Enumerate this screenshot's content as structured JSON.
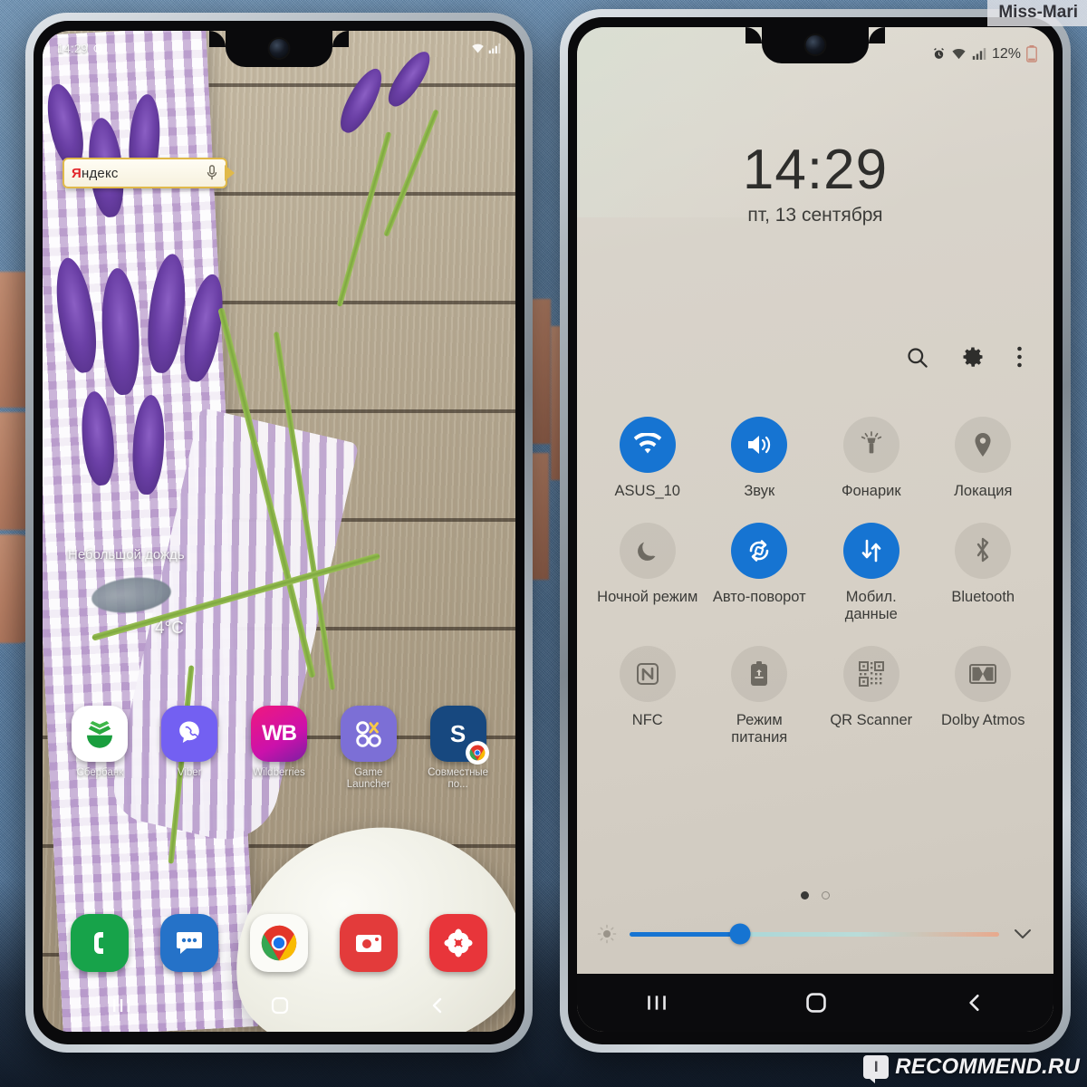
{
  "watermarks": {
    "top_right": "Miss-Mari",
    "bottom_right": "RECOMMEND.RU",
    "badge_glyph": "I"
  },
  "left_phone": {
    "screen_name": "home-screen",
    "status_bar": {
      "time": "14:29",
      "icons": [
        "alarm-icon",
        "wifi-icon",
        "signal-icon"
      ]
    },
    "search_widget": {
      "brand_first_letter": "Я",
      "brand_rest": "ндекс",
      "mic_icon": "microphone-icon"
    },
    "weather": {
      "description": "Небольшой дождь",
      "temperature": "4°C",
      "icon": "rain-cloud-icon"
    },
    "apps": [
      {
        "label": "Сбербанк",
        "icon": "sberbank-icon"
      },
      {
        "label": "Viber",
        "icon": "viber-icon"
      },
      {
        "label": "Wildberries",
        "icon": "wildberries-icon"
      },
      {
        "label": "Game Launcher",
        "icon": "game-launcher-icon"
      },
      {
        "label": "Совместные по...",
        "icon": "samsung-shared-icon"
      }
    ],
    "dock": [
      {
        "label": "Телефон",
        "icon": "phone-icon"
      },
      {
        "label": "Сообщения",
        "icon": "messages-icon"
      },
      {
        "label": "Chrome",
        "icon": "chrome-icon"
      },
      {
        "label": "Камера",
        "icon": "camera-icon"
      },
      {
        "label": "Галерея",
        "icon": "gallery-icon"
      }
    ],
    "navbar": {
      "recents": "recents-icon",
      "home": "home-icon",
      "back": "back-icon"
    }
  },
  "right_phone": {
    "screen_name": "quick-settings-panel",
    "status_bar": {
      "battery_percent": "12%",
      "icons": [
        "alarm-icon",
        "wifi-icon",
        "signal-icon",
        "battery-icon"
      ]
    },
    "clock": "14:29",
    "date": "пт, 13 сентября",
    "header_actions": [
      {
        "name": "search-icon"
      },
      {
        "name": "settings-gear-icon"
      },
      {
        "name": "more-options-icon"
      }
    ],
    "toggles": [
      [
        {
          "label": "ASUS_10",
          "icon": "wifi-icon",
          "active": true
        },
        {
          "label": "Звук",
          "icon": "sound-icon",
          "active": true
        },
        {
          "label": "Фонарик",
          "icon": "flashlight-icon",
          "active": false
        },
        {
          "label": "Локация",
          "icon": "location-pin-icon",
          "active": false
        }
      ],
      [
        {
          "label": "Ночной режим",
          "icon": "moon-icon",
          "active": false
        },
        {
          "label": "Авто-поворот",
          "icon": "auto-rotate-icon",
          "active": true
        },
        {
          "label": "Мобил. данные",
          "icon": "mobile-data-icon",
          "active": true
        },
        {
          "label": "Bluetooth",
          "icon": "bluetooth-icon",
          "active": false
        }
      ],
      [
        {
          "label": "NFC",
          "icon": "nfc-icon",
          "active": false
        },
        {
          "label": "Режим питания",
          "icon": "power-mode-icon",
          "active": false
        },
        {
          "label": "QR Scanner",
          "icon": "qr-scanner-icon",
          "active": false
        },
        {
          "label": "Dolby Atmos",
          "icon": "dolby-atmos-icon",
          "active": false
        }
      ]
    ],
    "page_indicator": {
      "total": 2,
      "current": 1
    },
    "brightness": {
      "value_percent": 30,
      "low_icon": "brightness-low-icon",
      "expand_icon": "chevron-down-icon"
    },
    "navbar": {
      "recents": "recents-icon",
      "home": "home-icon",
      "back": "back-icon"
    }
  },
  "colors": {
    "toggle_active": "#1674d2",
    "panel_bg": "#d6d0c6",
    "yandex_red": "#e2252a",
    "yandex_border": "#e0b94a"
  }
}
